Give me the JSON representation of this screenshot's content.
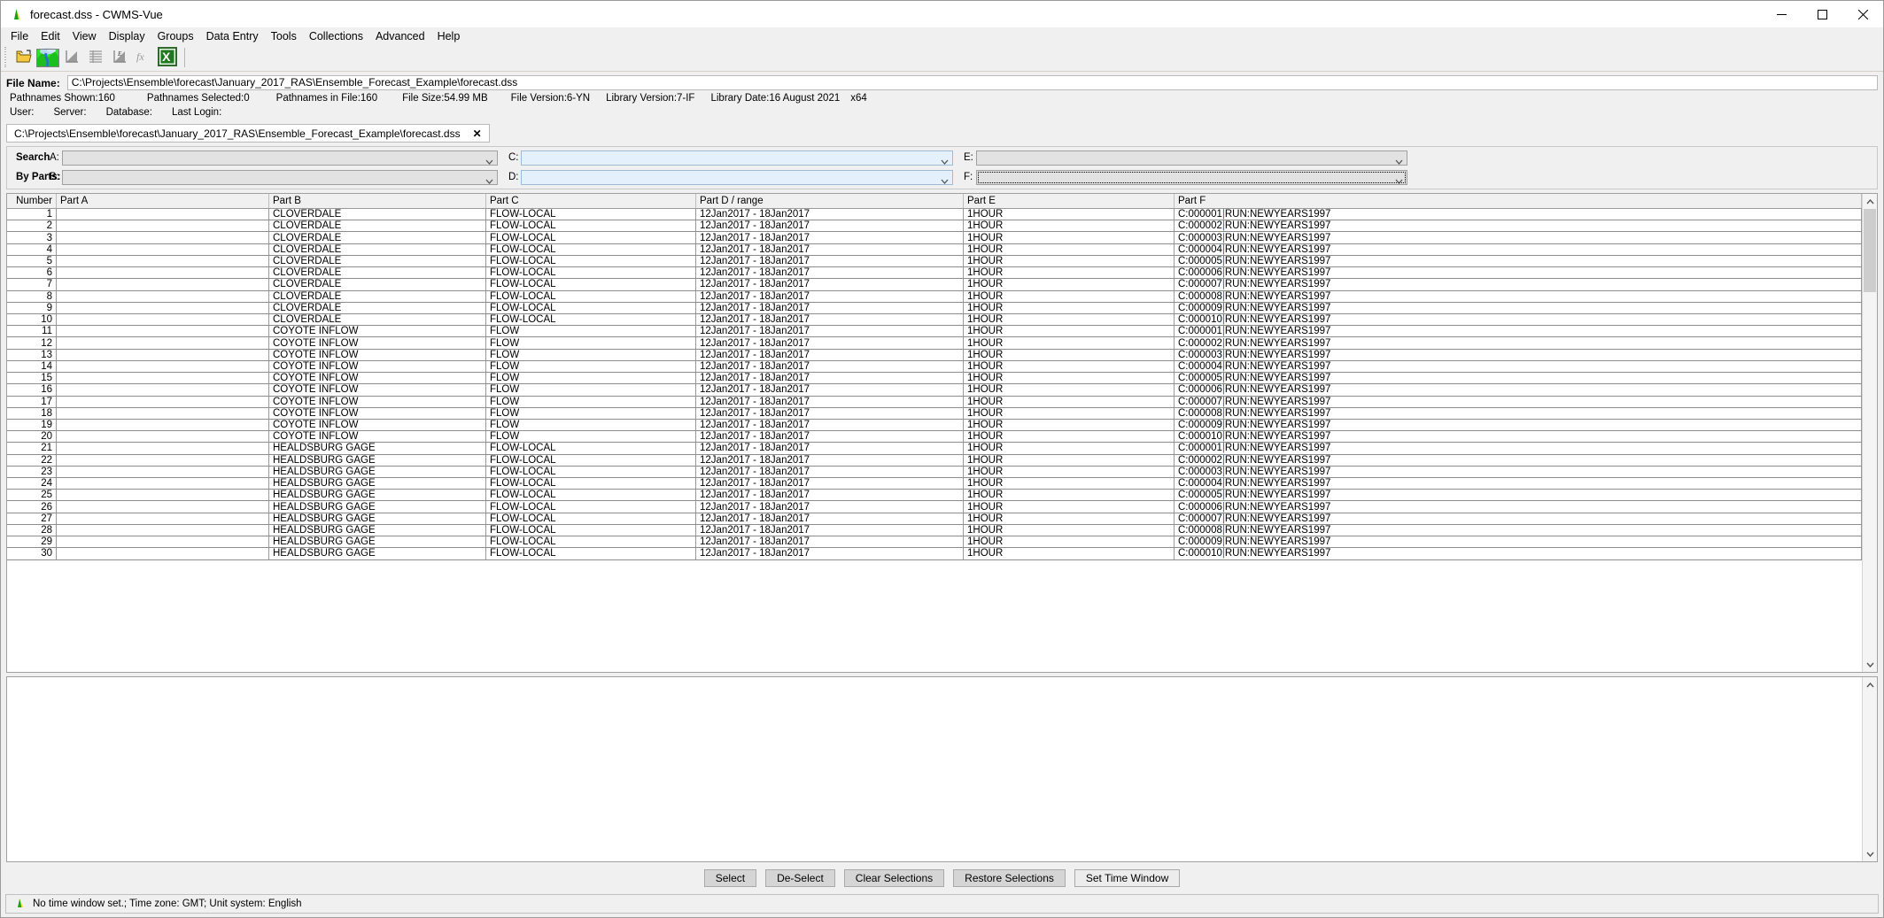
{
  "window": {
    "title": "forecast.dss - CWMS-Vue",
    "minimize_label": "minimize-icon",
    "maximize_label": "maximize-icon",
    "close_label": "close-icon"
  },
  "menubar": {
    "items": [
      {
        "label": "File"
      },
      {
        "label": "Edit"
      },
      {
        "label": "View"
      },
      {
        "label": "Display"
      },
      {
        "label": "Groups"
      },
      {
        "label": "Data Entry"
      },
      {
        "label": "Tools"
      },
      {
        "label": "Collections"
      },
      {
        "label": "Advanced"
      },
      {
        "label": "Help"
      }
    ]
  },
  "toolbar": {
    "buttons": [
      {
        "name": "open-file-icon"
      },
      {
        "name": "watershed-icon"
      },
      {
        "name": "plot-icon"
      },
      {
        "name": "table-icon"
      },
      {
        "name": "edit-plot-icon"
      },
      {
        "name": "math-function-icon"
      },
      {
        "name": "excel-export-icon"
      }
    ]
  },
  "file_info": {
    "file_name_label": "File Name:",
    "file_name_value": "C:\\Projects\\Ensemble\\forecast\\January_2017_RAS\\Ensemble_Forecast_Example\\forecast.dss",
    "stats": [
      {
        "label": "Pathnames Shown:",
        "value": "160"
      },
      {
        "label": "Pathnames Selected:",
        "value": "0"
      },
      {
        "label": "Pathnames in File:",
        "value": "160"
      },
      {
        "label": "File Size:",
        "value": "54.99  MB"
      },
      {
        "label": "File Version:",
        "value": "6-YN"
      },
      {
        "label": "Library Version:",
        "value": "7-IF"
      },
      {
        "label": "Library Date:",
        "value": "16 August 2021"
      },
      {
        "label": "x64",
        "value": ""
      }
    ],
    "session": [
      {
        "label": "User:"
      },
      {
        "label": "Server:"
      },
      {
        "label": "Database:"
      },
      {
        "label": "Last Login:"
      }
    ]
  },
  "tab": {
    "label": "C:\\Projects\\Ensemble\\forecast\\January_2017_RAS\\Ensemble_Forecast_Example\\forecast.dss",
    "close": "✕"
  },
  "search": {
    "title_line1": "Search",
    "title_line2": "By Parts:",
    "fields": [
      {
        "label": "A:",
        "value": "",
        "style": "grey"
      },
      {
        "label": "B:",
        "value": "",
        "style": "grey"
      },
      {
        "label": "C:",
        "value": "",
        "style": "blue"
      },
      {
        "label": "D:",
        "value": "",
        "style": "blue"
      },
      {
        "label": "E:",
        "value": "",
        "style": "grey"
      },
      {
        "label": "F:",
        "value": "",
        "style": "focused"
      }
    ]
  },
  "table": {
    "columns": [
      "Number",
      "Part A",
      "Part B",
      "Part C",
      "Part D / range",
      "Part E",
      "Part F"
    ],
    "rows": [
      {
        "number": "1",
        "a": "",
        "b": "CLOVERDALE",
        "c": "FLOW-LOCAL",
        "d": "12Jan2017 - 18Jan2017",
        "e": "1HOUR",
        "f1": "C:000001",
        "f2": "RUN:NEWYEARS1997"
      },
      {
        "number": "2",
        "a": "",
        "b": "CLOVERDALE",
        "c": "FLOW-LOCAL",
        "d": "12Jan2017 - 18Jan2017",
        "e": "1HOUR",
        "f1": "C:000002",
        "f2": "RUN:NEWYEARS1997"
      },
      {
        "number": "3",
        "a": "",
        "b": "CLOVERDALE",
        "c": "FLOW-LOCAL",
        "d": "12Jan2017 - 18Jan2017",
        "e": "1HOUR",
        "f1": "C:000003",
        "f2": "RUN:NEWYEARS1997"
      },
      {
        "number": "4",
        "a": "",
        "b": "CLOVERDALE",
        "c": "FLOW-LOCAL",
        "d": "12Jan2017 - 18Jan2017",
        "e": "1HOUR",
        "f1": "C:000004",
        "f2": "RUN:NEWYEARS1997"
      },
      {
        "number": "5",
        "a": "",
        "b": "CLOVERDALE",
        "c": "FLOW-LOCAL",
        "d": "12Jan2017 - 18Jan2017",
        "e": "1HOUR",
        "f1": "C:000005",
        "f2": "RUN:NEWYEARS1997"
      },
      {
        "number": "6",
        "a": "",
        "b": "CLOVERDALE",
        "c": "FLOW-LOCAL",
        "d": "12Jan2017 - 18Jan2017",
        "e": "1HOUR",
        "f1": "C:000006",
        "f2": "RUN:NEWYEARS1997"
      },
      {
        "number": "7",
        "a": "",
        "b": "CLOVERDALE",
        "c": "FLOW-LOCAL",
        "d": "12Jan2017 - 18Jan2017",
        "e": "1HOUR",
        "f1": "C:000007",
        "f2": "RUN:NEWYEARS1997"
      },
      {
        "number": "8",
        "a": "",
        "b": "CLOVERDALE",
        "c": "FLOW-LOCAL",
        "d": "12Jan2017 - 18Jan2017",
        "e": "1HOUR",
        "f1": "C:000008",
        "f2": "RUN:NEWYEARS1997"
      },
      {
        "number": "9",
        "a": "",
        "b": "CLOVERDALE",
        "c": "FLOW-LOCAL",
        "d": "12Jan2017 - 18Jan2017",
        "e": "1HOUR",
        "f1": "C:000009",
        "f2": "RUN:NEWYEARS1997"
      },
      {
        "number": "10",
        "a": "",
        "b": "CLOVERDALE",
        "c": "FLOW-LOCAL",
        "d": "12Jan2017 - 18Jan2017",
        "e": "1HOUR",
        "f1": "C:000010",
        "f2": "RUN:NEWYEARS1997"
      },
      {
        "number": "11",
        "a": "",
        "b": "COYOTE INFLOW",
        "c": "FLOW",
        "d": "12Jan2017 - 18Jan2017",
        "e": "1HOUR",
        "f1": "C:000001",
        "f2": "RUN:NEWYEARS1997"
      },
      {
        "number": "12",
        "a": "",
        "b": "COYOTE INFLOW",
        "c": "FLOW",
        "d": "12Jan2017 - 18Jan2017",
        "e": "1HOUR",
        "f1": "C:000002",
        "f2": "RUN:NEWYEARS1997"
      },
      {
        "number": "13",
        "a": "",
        "b": "COYOTE INFLOW",
        "c": "FLOW",
        "d": "12Jan2017 - 18Jan2017",
        "e": "1HOUR",
        "f1": "C:000003",
        "f2": "RUN:NEWYEARS1997"
      },
      {
        "number": "14",
        "a": "",
        "b": "COYOTE INFLOW",
        "c": "FLOW",
        "d": "12Jan2017 - 18Jan2017",
        "e": "1HOUR",
        "f1": "C:000004",
        "f2": "RUN:NEWYEARS1997"
      },
      {
        "number": "15",
        "a": "",
        "b": "COYOTE INFLOW",
        "c": "FLOW",
        "d": "12Jan2017 - 18Jan2017",
        "e": "1HOUR",
        "f1": "C:000005",
        "f2": "RUN:NEWYEARS1997"
      },
      {
        "number": "16",
        "a": "",
        "b": "COYOTE INFLOW",
        "c": "FLOW",
        "d": "12Jan2017 - 18Jan2017",
        "e": "1HOUR",
        "f1": "C:000006",
        "f2": "RUN:NEWYEARS1997"
      },
      {
        "number": "17",
        "a": "",
        "b": "COYOTE INFLOW",
        "c": "FLOW",
        "d": "12Jan2017 - 18Jan2017",
        "e": "1HOUR",
        "f1": "C:000007",
        "f2": "RUN:NEWYEARS1997"
      },
      {
        "number": "18",
        "a": "",
        "b": "COYOTE INFLOW",
        "c": "FLOW",
        "d": "12Jan2017 - 18Jan2017",
        "e": "1HOUR",
        "f1": "C:000008",
        "f2": "RUN:NEWYEARS1997"
      },
      {
        "number": "19",
        "a": "",
        "b": "COYOTE INFLOW",
        "c": "FLOW",
        "d": "12Jan2017 - 18Jan2017",
        "e": "1HOUR",
        "f1": "C:000009",
        "f2": "RUN:NEWYEARS1997"
      },
      {
        "number": "20",
        "a": "",
        "b": "COYOTE INFLOW",
        "c": "FLOW",
        "d": "12Jan2017 - 18Jan2017",
        "e": "1HOUR",
        "f1": "C:000010",
        "f2": "RUN:NEWYEARS1997"
      },
      {
        "number": "21",
        "a": "",
        "b": "HEALDSBURG GAGE",
        "c": "FLOW-LOCAL",
        "d": "12Jan2017 - 18Jan2017",
        "e": "1HOUR",
        "f1": "C:000001",
        "f2": "RUN:NEWYEARS1997"
      },
      {
        "number": "22",
        "a": "",
        "b": "HEALDSBURG GAGE",
        "c": "FLOW-LOCAL",
        "d": "12Jan2017 - 18Jan2017",
        "e": "1HOUR",
        "f1": "C:000002",
        "f2": "RUN:NEWYEARS1997"
      },
      {
        "number": "23",
        "a": "",
        "b": "HEALDSBURG GAGE",
        "c": "FLOW-LOCAL",
        "d": "12Jan2017 - 18Jan2017",
        "e": "1HOUR",
        "f1": "C:000003",
        "f2": "RUN:NEWYEARS1997"
      },
      {
        "number": "24",
        "a": "",
        "b": "HEALDSBURG GAGE",
        "c": "FLOW-LOCAL",
        "d": "12Jan2017 - 18Jan2017",
        "e": "1HOUR",
        "f1": "C:000004",
        "f2": "RUN:NEWYEARS1997"
      },
      {
        "number": "25",
        "a": "",
        "b": "HEALDSBURG GAGE",
        "c": "FLOW-LOCAL",
        "d": "12Jan2017 - 18Jan2017",
        "e": "1HOUR",
        "f1": "C:000005",
        "f2": "RUN:NEWYEARS1997"
      },
      {
        "number": "26",
        "a": "",
        "b": "HEALDSBURG GAGE",
        "c": "FLOW-LOCAL",
        "d": "12Jan2017 - 18Jan2017",
        "e": "1HOUR",
        "f1": "C:000006",
        "f2": "RUN:NEWYEARS1997"
      },
      {
        "number": "27",
        "a": "",
        "b": "HEALDSBURG GAGE",
        "c": "FLOW-LOCAL",
        "d": "12Jan2017 - 18Jan2017",
        "e": "1HOUR",
        "f1": "C:000007",
        "f2": "RUN:NEWYEARS1997"
      },
      {
        "number": "28",
        "a": "",
        "b": "HEALDSBURG GAGE",
        "c": "FLOW-LOCAL",
        "d": "12Jan2017 - 18Jan2017",
        "e": "1HOUR",
        "f1": "C:000008",
        "f2": "RUN:NEWYEARS1997"
      },
      {
        "number": "29",
        "a": "",
        "b": "HEALDSBURG GAGE",
        "c": "FLOW-LOCAL",
        "d": "12Jan2017 - 18Jan2017",
        "e": "1HOUR",
        "f1": "C:000009",
        "f2": "RUN:NEWYEARS1997"
      },
      {
        "number": "30",
        "a": "",
        "b": "HEALDSBURG GAGE",
        "c": "FLOW-LOCAL",
        "d": "12Jan2017 - 18Jan2017",
        "e": "1HOUR",
        "f1": "C:000010",
        "f2": "RUN:NEWYEARS1997"
      }
    ]
  },
  "buttons": [
    {
      "label": "Select",
      "name": "select-button"
    },
    {
      "label": "De-Select",
      "name": "de-select-button"
    },
    {
      "label": "Clear Selections",
      "name": "clear-selections-button"
    },
    {
      "label": "Restore Selections",
      "name": "restore-selections-button"
    },
    {
      "label": "Set Time Window",
      "name": "set-time-window-button"
    }
  ],
  "status": {
    "text": "No time window set.;  Time zone: GMT;  Unit system: English"
  }
}
